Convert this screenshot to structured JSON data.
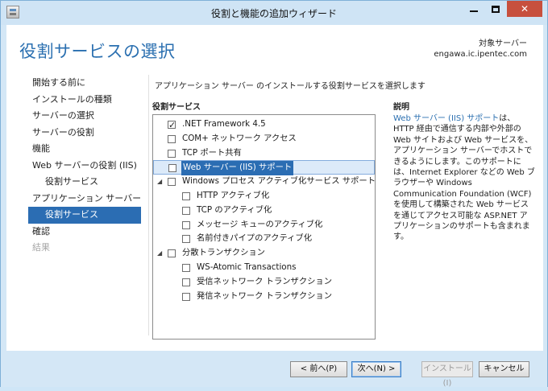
{
  "window": {
    "title": "役割と機能の追加ウィザード",
    "minimize": "",
    "maximize": "",
    "close": "✕"
  },
  "page": {
    "title": "役割サービスの選択",
    "dest_label": "対象サーバー",
    "dest_server": "engawa.ic.ipentec.com",
    "header": "アプリケーション サーバー のインストールする役割サービスを選択します"
  },
  "nav": [
    {
      "label": "開始する前に",
      "state": "normal"
    },
    {
      "label": "インストールの種類",
      "state": "normal"
    },
    {
      "label": "サーバーの選択",
      "state": "normal"
    },
    {
      "label": "サーバーの役割",
      "state": "normal"
    },
    {
      "label": "機能",
      "state": "normal"
    },
    {
      "label": "Web サーバーの役割 (IIS)",
      "state": "normal"
    },
    {
      "label": "役割サービス",
      "state": "sub"
    },
    {
      "label": "アプリケーション サーバー",
      "state": "normal"
    },
    {
      "label": "役割サービス",
      "state": "sub-active"
    },
    {
      "label": "確認",
      "state": "normal"
    },
    {
      "label": "結果",
      "state": "disabled"
    }
  ],
  "roles": {
    "label": "役割サービス",
    "items": [
      {
        "label": ".NET Framework 4.5",
        "level": 0,
        "checked": true,
        "expander": false,
        "selected": false
      },
      {
        "label": "COM+ ネットワーク アクセス",
        "level": 0,
        "checked": false,
        "expander": false,
        "selected": false
      },
      {
        "label": "TCP ポート共有",
        "level": 0,
        "checked": false,
        "expander": false,
        "selected": false
      },
      {
        "label": "Web サーバー (IIS) サポート",
        "level": 0,
        "checked": false,
        "expander": false,
        "selected": true
      },
      {
        "label": "Windows プロセス アクティブ化サービス サポート",
        "level": 0,
        "checked": false,
        "expander": true,
        "selected": false
      },
      {
        "label": "HTTP アクティブ化",
        "level": 1,
        "checked": false,
        "expander": false,
        "selected": false
      },
      {
        "label": "TCP のアクティブ化",
        "level": 1,
        "checked": false,
        "expander": false,
        "selected": false
      },
      {
        "label": "メッセージ キューのアクティブ化",
        "level": 1,
        "checked": false,
        "expander": false,
        "selected": false
      },
      {
        "label": "名前付きパイプのアクティブ化",
        "level": 1,
        "checked": false,
        "expander": false,
        "selected": false
      },
      {
        "label": "分散トランザクション",
        "level": 0,
        "checked": false,
        "expander": true,
        "selected": false
      },
      {
        "label": "WS-Atomic Transactions",
        "level": 1,
        "checked": false,
        "expander": false,
        "selected": false
      },
      {
        "label": "受信ネットワーク トランザクション",
        "level": 1,
        "checked": false,
        "expander": false,
        "selected": false
      },
      {
        "label": "発信ネットワーク トランザクション",
        "level": 1,
        "checked": false,
        "expander": false,
        "selected": false
      }
    ]
  },
  "description": {
    "label": "説明",
    "link_text": "Web サーバー (IIS) サポート",
    "body": "は、HTTP 経由で通信する内部や外部の Web サイトおよび Web サービスを、アプリケーション サーバーでホストできるようにします。このサポートには、Internet Explorer などの Web ブラウザーや Windows Communication Foundation (WCF) を使用して構築された Web サービスを通じてアクセス可能な ASP.NET アプリケーションのサポートも含まれます。"
  },
  "buttons": {
    "prev": "< 前へ(P)",
    "next": "次へ(N) >",
    "install": "インストール(I)",
    "cancel": "キャンセル"
  }
}
